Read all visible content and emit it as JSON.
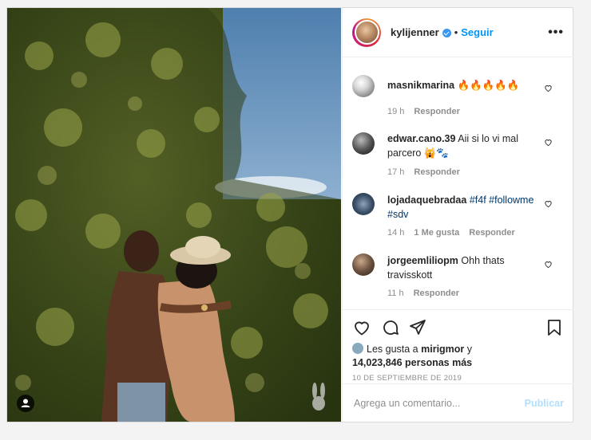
{
  "post": {
    "username": "kylijenner",
    "follow_label": "Seguir",
    "dot": "•",
    "more": "•••"
  },
  "comments": [
    {
      "user": "masnikmarina",
      "text": "🔥🔥🔥🔥🔥",
      "time": "19 h",
      "likes": "",
      "reply": "Responder"
    },
    {
      "user": "edwar.cano.39",
      "text": "Aii si lo vi mal parcero 🙀🐾",
      "time": "17 h",
      "likes": "",
      "reply": "Responder"
    },
    {
      "user": "lojadaquebradaa",
      "text": "#f4f #followme #sdv",
      "time": "14 h",
      "likes": "1 Me gusta",
      "reply": "Responder"
    },
    {
      "user": "jorgeemliliopm",
      "text": "Ohh thats travisskott",
      "time": "11 h",
      "likes": "",
      "reply": "Responder"
    }
  ],
  "likes": {
    "prefix": "Les gusta a",
    "first_user": "mirigmor",
    "connector": "y",
    "count": "14,023,846 personas más"
  },
  "date": "10 DE SEPTIEMBRE DE 2019",
  "add_comment": {
    "placeholder": "Agrega un comentario...",
    "publish": "Publicar"
  },
  "icons": [
    "heart-icon",
    "comment-icon",
    "share-icon",
    "bookmark-icon",
    "verified-icon",
    "user-tag-icon",
    "playboy-watermark-icon"
  ],
  "colors": {
    "accent": "#0095f6",
    "verified": "#3897f0",
    "publish_disabled": "#b2dffc"
  }
}
